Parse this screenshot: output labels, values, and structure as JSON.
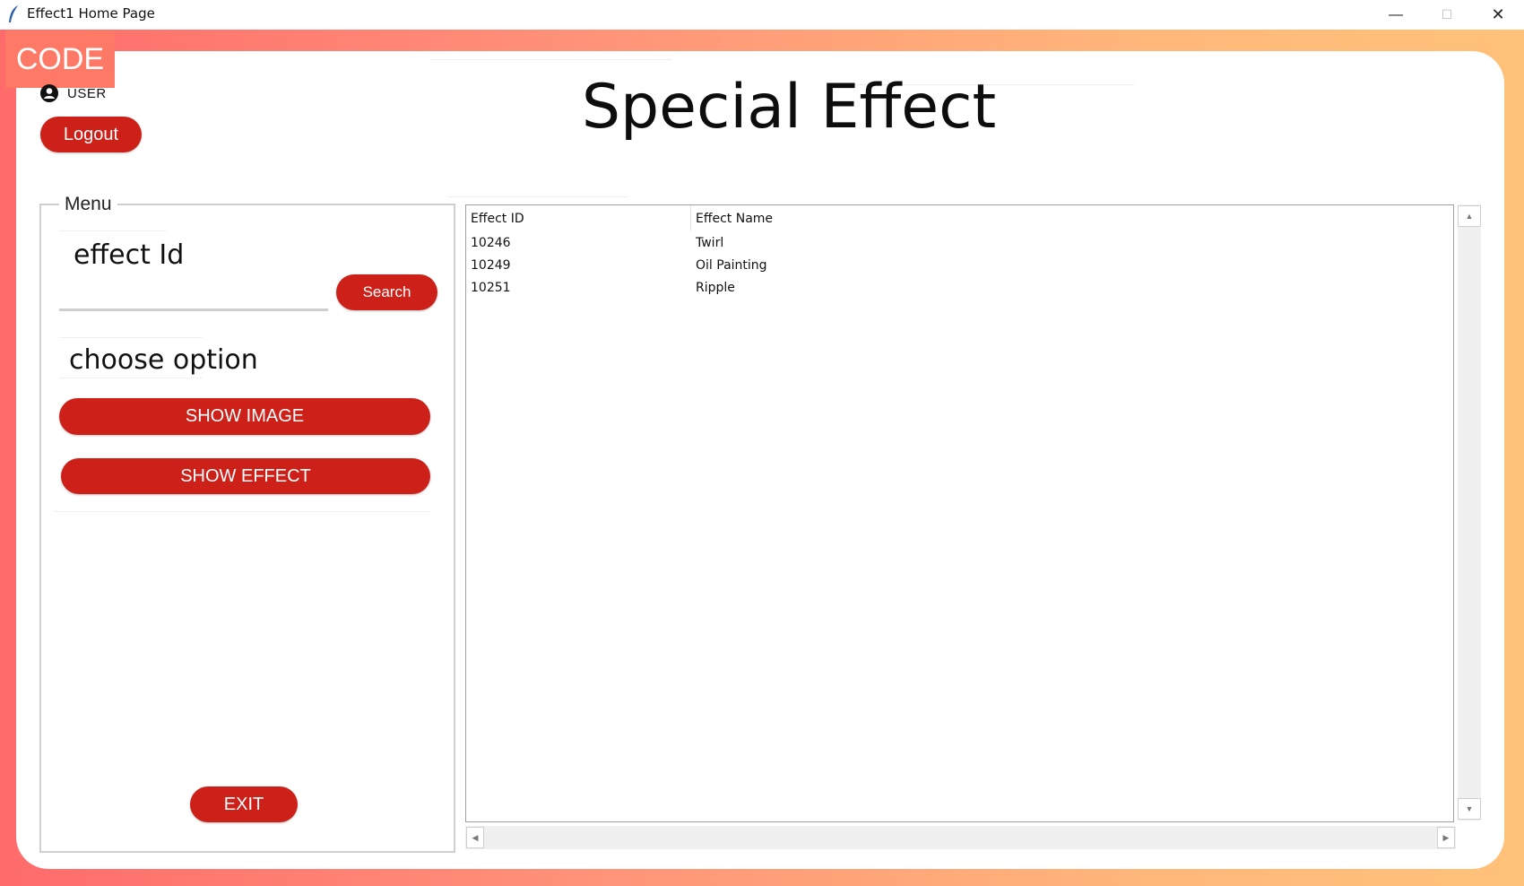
{
  "window": {
    "title": "Effect1 Home Page",
    "minimize_icon": "minimize-icon",
    "maximize_icon": "maximize-icon",
    "close_icon": "close-icon",
    "minimize_glyph": "—",
    "maximize_glyph": "☐",
    "close_glyph": "✕"
  },
  "brand": {
    "tag": "CODE",
    "tag_color": "#ff7a66"
  },
  "user": {
    "label": "USER",
    "icon": "user-icon"
  },
  "header": {
    "logout_label": "Logout",
    "title": "Special Effect"
  },
  "menu": {
    "legend": "Menu",
    "effect_id_label": "effect Id",
    "effect_id_value": "",
    "search_label": "Search",
    "choose_label": "choose option",
    "show_image_label": "SHOW IMAGE",
    "show_effect_label": "SHOW EFFECT",
    "exit_label": "EXIT"
  },
  "table": {
    "columns": [
      "Effect ID",
      "Effect Name"
    ],
    "rows": [
      [
        "10246",
        "Twirl"
      ],
      [
        "10249",
        "Oil Painting"
      ],
      [
        "10251",
        "Ripple"
      ]
    ]
  },
  "scrollbars": {
    "up_glyph": "▲",
    "down_glyph": "▼",
    "left_glyph": "◀",
    "right_glyph": "▶"
  },
  "colors": {
    "accent_red": "#cc2018",
    "gradient_start": "#ff6b6b",
    "gradient_end": "#ffc27a"
  }
}
